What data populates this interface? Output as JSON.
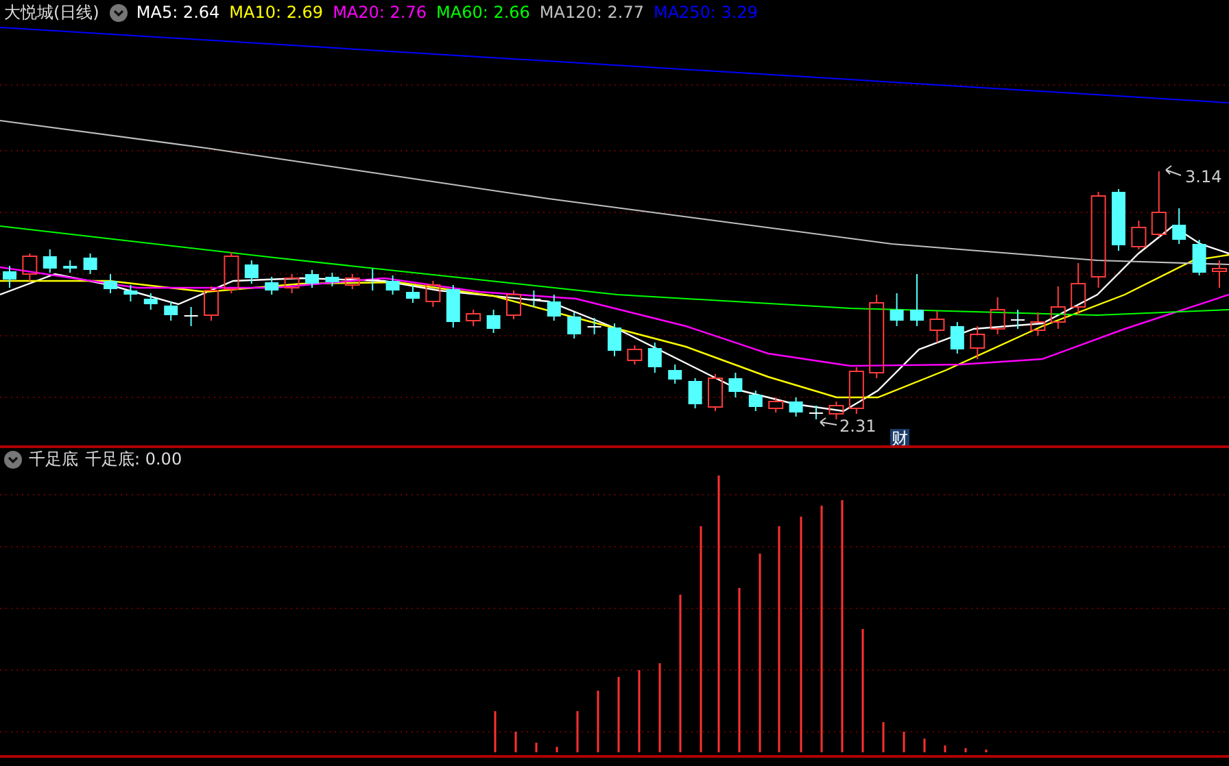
{
  "header": {
    "title": "大悦城(日线)",
    "indicators": [
      {
        "label": "MA5: 2.64",
        "color": "#ffffff"
      },
      {
        "label": "MA10: 2.69",
        "color": "#ffff00"
      },
      {
        "label": "MA20: 2.76",
        "color": "#ff00ff"
      },
      {
        "label": "MA60: 2.66",
        "color": "#00ff00"
      },
      {
        "label": "MA120: 2.77",
        "color": "#c0c0c0"
      },
      {
        "label": "MA250: 3.29",
        "color": "#0000ff"
      }
    ]
  },
  "price_chart": {
    "high_label": "3.14",
    "low_label": "2.31",
    "badge": "财"
  },
  "sub_panel": {
    "title": "千足底",
    "reading": "千足底: 0.00"
  }
}
